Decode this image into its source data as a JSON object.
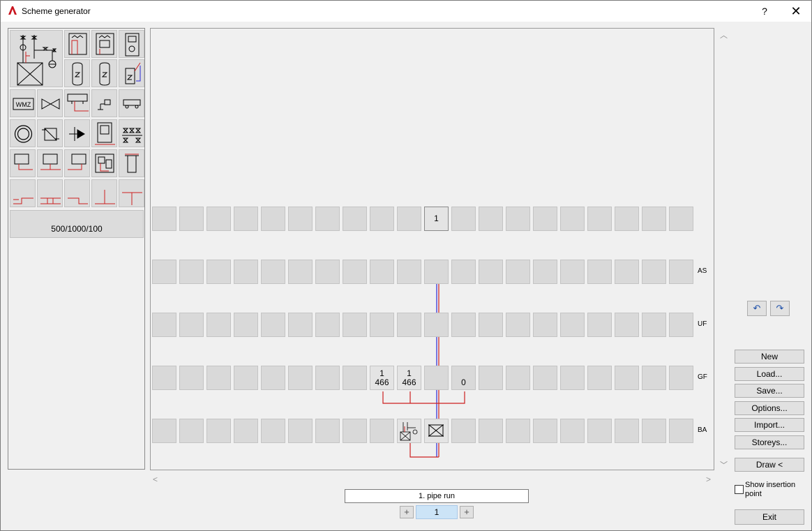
{
  "window": {
    "title": "Scheme generator",
    "help_label": "?",
    "close_label": "✕"
  },
  "palette": {
    "icons": [
      "boiler-station-icon",
      "wall-boiler-icon",
      "wall-boiler-panel-icon",
      "gas-boiler-icon",
      "storage-tank-icon",
      "storage-tank-coil-icon",
      "solar-storage-icon",
      "heat-meter-icon",
      "valve-icon",
      "manifold-icon",
      "tap-icon",
      "pump-group-icon",
      "tank-round-icon",
      "heat-exchanger-icon",
      "pump-icon",
      "cabinet-icon",
      "valve-group-icon",
      "radiator-icon",
      "radiator-center-icon",
      "radiator-right-icon",
      "control-unit-icon",
      "cylinder-icon",
      "pipe-left-icon",
      "pipe-double-icon",
      "pipe-right-icon",
      "pipe-junction-icon",
      "pipe-tee-icon"
    ],
    "wmz_label": "WMZ",
    "size_button": "500/1000/100"
  },
  "grid": {
    "storeys": [
      "AS",
      "UF",
      "GF",
      "BA"
    ],
    "top_row_cell": "1",
    "gf_cells": [
      {
        "top": "1",
        "bottom": "466"
      },
      {
        "top": "1",
        "bottom": "466"
      },
      {
        "top": "",
        "bottom": "0"
      }
    ]
  },
  "buttons": {
    "undo": "↶",
    "redo": "↷",
    "new": "New",
    "load": "Load...",
    "save": "Save...",
    "options": "Options...",
    "import": "Import...",
    "storeys": "Storeys...",
    "draw": "Draw <",
    "exit": "Exit"
  },
  "show_insertion": {
    "label": "Show insertion point",
    "checked": false
  },
  "pipe_run": {
    "name": "1. pipe run",
    "number": "1",
    "minus": "+",
    "plus": "+"
  },
  "colors": {
    "pipe_red": "#cc1f1f",
    "pipe_blue": "#2a2ad8"
  }
}
